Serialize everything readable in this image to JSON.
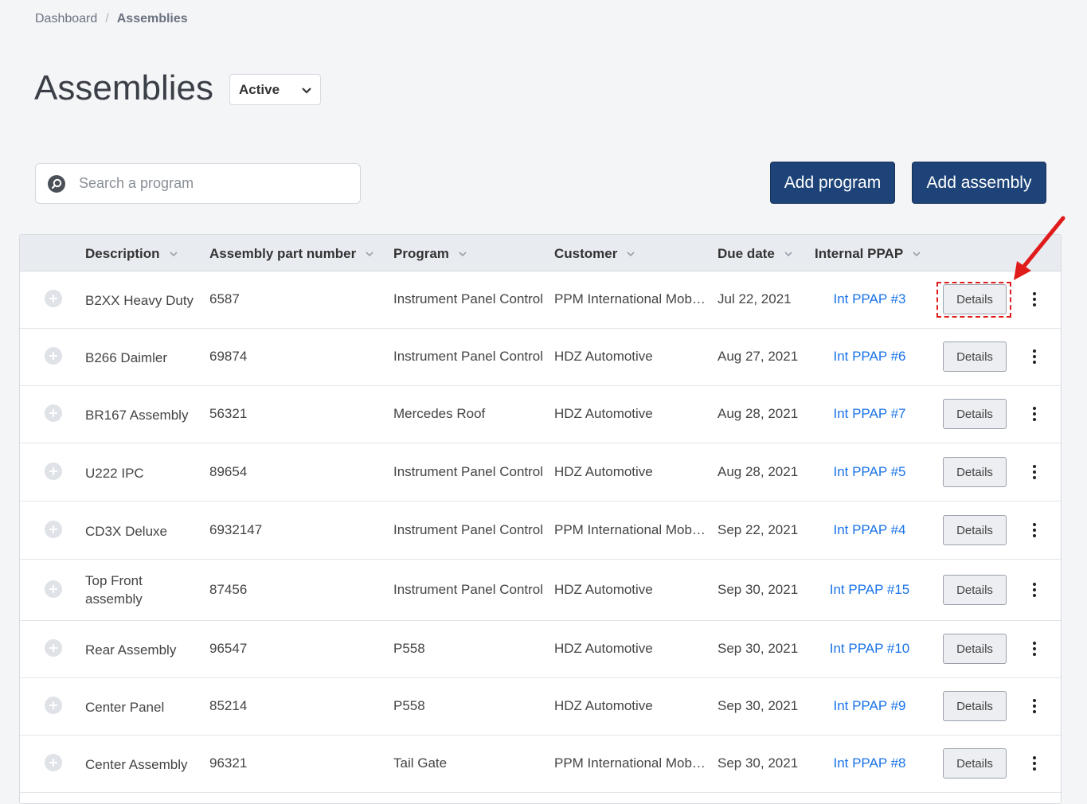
{
  "breadcrumb": {
    "root": "Dashboard",
    "separator": "/",
    "current": "Assemblies"
  },
  "page": {
    "title": "Assemblies",
    "status_filter": "Active"
  },
  "search": {
    "placeholder": "Search a program",
    "value": ""
  },
  "actions": {
    "add_program": "Add program",
    "add_assembly": "Add assembly"
  },
  "columns": {
    "description": "Description",
    "part_number": "Assembly part number",
    "program": "Program",
    "customer": "Customer",
    "due_date": "Due date",
    "internal_ppap": "Internal PPAP"
  },
  "details_label": "Details",
  "rows": [
    {
      "description": "B2XX Heavy Duty",
      "part_number": "6587",
      "program": "Instrument Panel Control",
      "customer": "PPM International Mob…",
      "due_date": "Jul 22, 2021",
      "ppap": "Int PPAP #3"
    },
    {
      "description": "B266 Daimler",
      "part_number": "69874",
      "program": "Instrument Panel Control",
      "customer": "HDZ Automotive",
      "due_date": "Aug 27, 2021",
      "ppap": "Int PPAP #6"
    },
    {
      "description": "BR167 Assembly",
      "part_number": "56321",
      "program": "Mercedes Roof",
      "customer": "HDZ Automotive",
      "due_date": "Aug 28, 2021",
      "ppap": "Int PPAP #7"
    },
    {
      "description": "U222 IPC",
      "part_number": "89654",
      "program": "Instrument Panel Control",
      "customer": "HDZ Automotive",
      "due_date": "Aug 28, 2021",
      "ppap": "Int PPAP #5"
    },
    {
      "description": "CD3X Deluxe",
      "part_number": "6932147",
      "program": "Instrument Panel Control",
      "customer": "PPM International Mob…",
      "due_date": "Sep 22, 2021",
      "ppap": "Int PPAP #4"
    },
    {
      "description": "Top Front assembly",
      "part_number": "87456",
      "program": "Instrument Panel Control",
      "customer": "HDZ Automotive",
      "due_date": "Sep 30, 2021",
      "ppap": "Int PPAP #15"
    },
    {
      "description": "Rear Assembly",
      "part_number": "96547",
      "program": "P558",
      "customer": "HDZ Automotive",
      "due_date": "Sep 30, 2021",
      "ppap": "Int PPAP #10"
    },
    {
      "description": "Center Panel",
      "part_number": "85214",
      "program": "P558",
      "customer": "HDZ Automotive",
      "due_date": "Sep 30, 2021",
      "ppap": "Int PPAP #9"
    },
    {
      "description": "Center Assembly",
      "part_number": "96321",
      "program": "Tail Gate",
      "customer": "PPM International Mob…",
      "due_date": "Sep 30, 2021",
      "ppap": "Int PPAP #8"
    }
  ],
  "colors": {
    "primary": "#1d4378",
    "link": "#1a73e8",
    "annotation": "#e01b1b"
  }
}
